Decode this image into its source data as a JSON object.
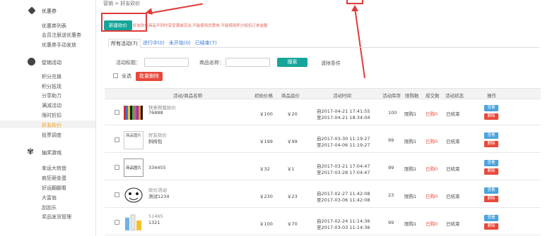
{
  "breadcrumb": "营销 > 好友砍价",
  "sidebar": {
    "groups": [
      {
        "heading": "优惠券",
        "icon": "coupon-icon",
        "items": [
          "优惠券列表",
          "会员注册送优惠券",
          "优惠券手动发放"
        ]
      },
      {
        "heading": "促销活动",
        "icon": "promotion-icon",
        "items": [
          "积分兑换",
          "积分抵现",
          "分享助力",
          "满减活动",
          "限时折扣",
          "好友砍价",
          "投票调查"
        ]
      },
      {
        "heading": "抽奖游戏",
        "icon": "lottery-icon",
        "items": [
          "幸运大转盘",
          "疯狂砸金蛋",
          "好运翻翻看",
          "大富翁",
          "刮刮乐",
          "奖品发货管理"
        ]
      }
    ],
    "active_item": "好友砍价"
  },
  "toolbar": {
    "new_button": "新建砍价",
    "hint": "好友砍价商品不同时享受满减活动,不能使用优惠券,不能使用积分抵扣订单金额"
  },
  "tabs": [
    "所有活动(7)",
    "进行中(0)",
    "未开始(0)",
    "已结束(7)"
  ],
  "filter": {
    "title_label": "活动标题：",
    "product_label": "商品名称：",
    "search_button": "搜索",
    "clear_label": "清除条件"
  },
  "select_all": "全选",
  "batch_delete": "批量删除",
  "table": {
    "headers": [
      "活动/商品名称",
      "初始价格",
      "商品底价",
      "活动时间",
      "活动库存",
      "限购数",
      "成交数",
      "活动状态",
      "操作"
    ],
    "rows": [
      {
        "activity": "快来帮我砍价",
        "product": "76888",
        "initial": "￥100",
        "floor": "￥20",
        "start": "自2017-04-21 17:41:55",
        "end": "至2017-04-21 18:34:04",
        "stock": "100",
        "limit": "限购1",
        "deals": "已购0",
        "status": "已结束",
        "thumb": "colorful"
      },
      {
        "activity": "好友砍价",
        "product": "斜挎包",
        "initial": "￥199",
        "floor": "￥99",
        "start": "自2017-03-30 11:19:27",
        "end": "至2017-04-06 11:19:27",
        "stock": "99",
        "limit": "限购1",
        "deals": "已购0",
        "status": "已结束",
        "thumb": "broken",
        "thumb_text": "商品图片"
      },
      {
        "activity": "",
        "product": "334455",
        "initial": "￥32",
        "floor": "￥1",
        "start": "自2017-03-21 17:04:47",
        "end": "至2017-03-28 17:04:47",
        "stock": "99",
        "limit": "限购1",
        "deals": "已购0",
        "status": "已结束",
        "thumb": "text",
        "thumb_text": "商品图片"
      },
      {
        "activity": "砍价活动",
        "product": "测试1234",
        "initial": "￥230",
        "floor": "￥23",
        "start": "自2017-02-27 11:42:08",
        "end": "至2017-03-06 11:42:08",
        "stock": "23",
        "limit": "限购1",
        "deals": "已购0",
        "status": "已结束",
        "thumb": "face"
      },
      {
        "activity": "51465",
        "product": "1321",
        "initial": "￥100",
        "floor": "￥70",
        "start": "自2017-02-24 11:14:36",
        "end": "至2017-03-03 11:14:36",
        "stock": "99",
        "limit": "限购1",
        "deals": "已购0",
        "status": "已结束",
        "thumb": "products"
      }
    ],
    "view_label": "查看",
    "delete_label": "删除"
  },
  "colors": {
    "accent": "#16a59a",
    "danger": "#e8483a",
    "link": "#3a7bd5",
    "active": "#f39c12"
  }
}
